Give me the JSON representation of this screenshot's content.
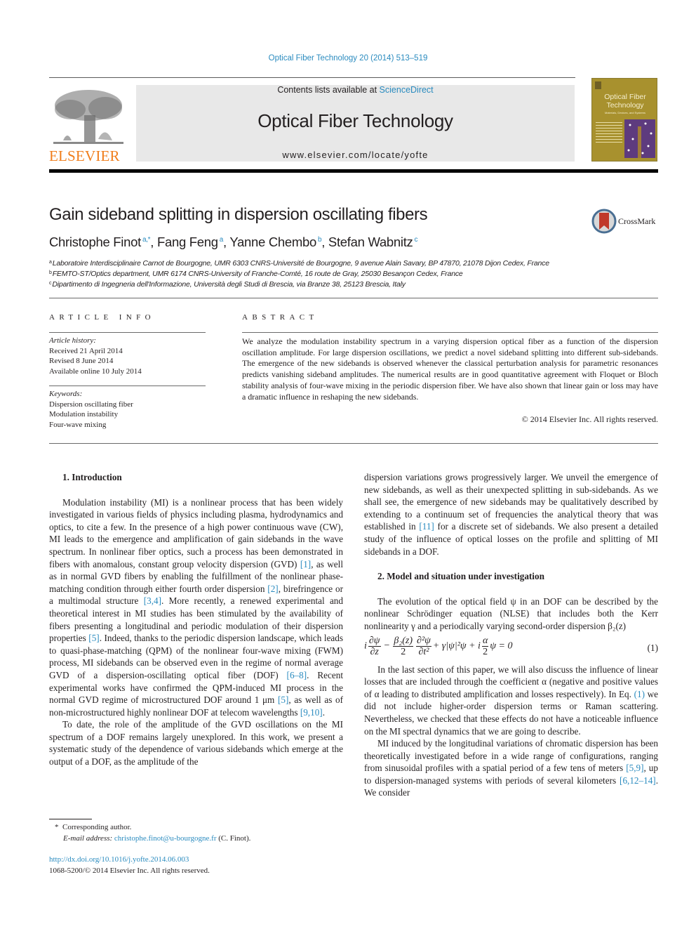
{
  "header": {
    "journal_ref": "Optical Fiber Technology 20 (2014) 513–519",
    "contents_prefix": "Contents lists available at ",
    "contents_link": "ScienceDirect",
    "journal_title": "Optical Fiber Technology",
    "journal_url": "www.elsevier.com/locate/yofte",
    "publisher_logo_text": "ELSEVIER",
    "cover": {
      "title_line1": "Optical Fiber",
      "title_line2": "Technology",
      "subtitle": "Materials, Devices, and Systems"
    }
  },
  "article": {
    "title": "Gain sideband splitting in dispersion oscillating fibers",
    "crossmark_label": "CrossMark",
    "authors": [
      {
        "name": "Christophe Finot",
        "sup": "a,*",
        "sep": ", "
      },
      {
        "name": "Fang Feng",
        "sup": "a",
        "sep": ", "
      },
      {
        "name": "Yanne Chembo",
        "sup": "b",
        "sep": ", "
      },
      {
        "name": "Stefan Wabnitz",
        "sup": "c",
        "sep": ""
      }
    ],
    "affiliations": [
      {
        "mark": "a",
        "text": "Laboratoire Interdisciplinaire Carnot de Bourgogne, UMR 6303 CNRS-Université de Bourgogne, 9 avenue Alain Savary, BP 47870, 21078 Dijon Cedex, France"
      },
      {
        "mark": "b",
        "text": "FEMTO-ST/Optics department, UMR 6174 CNRS-University of Franche-Comté, 16 route de Gray, 25030 Besançon Cedex, France"
      },
      {
        "mark": "c",
        "text": "Dipartimento di Ingegneria dell'Informazione, Università degli Studi di Brescia, via Branze 38, 25123 Brescia, Italy"
      }
    ]
  },
  "article_info": {
    "heading": "ARTICLE INFO",
    "history_label": "Article history:",
    "history": [
      "Received 21 April 2014",
      "Revised 8 June 2014",
      "Available online 10 July 2014"
    ],
    "keywords_label": "Keywords:",
    "keywords": [
      "Dispersion oscillating fiber",
      "Modulation instability",
      "Four-wave mixing"
    ]
  },
  "abstract": {
    "heading": "ABSTRACT",
    "text": "We analyze the modulation instability spectrum in a varying dispersion optical fiber as a function of the dispersion oscillation amplitude. For large dispersion oscillations, we predict a novel sideband splitting into different sub-sidebands. The emergence of the new sidebands is observed whenever the classical perturbation analysis for parametric resonances predicts vanishing sideband amplitudes. The numerical results are in good quantitative agreement with Floquet or Bloch stability analysis of four-wave mixing in the periodic dispersion fiber. We have also shown that linear gain or loss may have a dramatic influence in reshaping the new sidebands.",
    "copyright": "© 2014 Elsevier Inc. All rights reserved."
  },
  "body": {
    "sec1_heading": "1. Introduction",
    "sec1_p1": [
      {
        "t": "Modulation instability (MI) is a nonlinear process that has been widely investigated in various fields of physics including plasma, hydrodynamics and optics, to cite a few. In the presence of a high power continuous wave (CW), MI leads to the emergence and amplification of gain sidebands in the wave spectrum. In nonlinear fiber optics, such a process has been demonstrated in fibers with anomalous, constant group velocity dispersion (GVD) "
      },
      {
        "ref": "[1]"
      },
      {
        "t": ", as well as in normal GVD fibers by enabling the fulfillment of the nonlinear phase-matching condition through either fourth order dispersion "
      },
      {
        "ref": "[2]"
      },
      {
        "t": ", birefringence or a multimodal structure "
      },
      {
        "ref": "[3,4]"
      },
      {
        "t": ". More recently, a renewed experimental and theoretical interest in MI studies has been stimulated by the availability of fibers presenting a longitudinal and periodic modulation of their dispersion properties "
      },
      {
        "ref": "[5]"
      },
      {
        "t": ". Indeed, thanks to the periodic dispersion landscape, which leads to quasi-phase-matching (QPM) of the nonlinear four-wave mixing (FWM) process, MI sidebands can be observed even in the regime of normal average GVD of a dispersion-oscillating optical fiber (DOF) "
      },
      {
        "ref": "[6–8]"
      },
      {
        "t": ". Recent experimental works have confirmed the QPM-induced MI process in the normal GVD regime of microstructured DOF around 1 μm "
      },
      {
        "ref": "[5]"
      },
      {
        "t": ", as well as of non-microstructured highly nonlinear DOF at telecom wavelengths "
      },
      {
        "ref": "[9,10]"
      },
      {
        "t": "."
      }
    ],
    "sec1_p2_left": "To date, the role of the amplitude of the GVD oscillations on the MI spectrum of a DOF remains largely unexplored. In this work, we present a systematic study of the dependence of various sidebands which emerge at the output of a DOF, as the amplitude of the",
    "sec1_p2_right": [
      {
        "t": "dispersion variations grows progressively larger. We unveil the emergence of new sidebands, as well as their unexpected splitting in sub-sidebands. As we shall see, the emergence of new sidebands may be qualitatively described by extending to a continuum set of frequencies the analytical theory that was established in "
      },
      {
        "ref": "[11]"
      },
      {
        "t": " for a discrete set of sidebands. We also present a detailed study of the influence of optical losses on the profile and splitting of MI sidebands in a DOF."
      }
    ],
    "sec2_heading": "2. Model and situation under investigation",
    "sec2_p1": "The evolution of the optical field ψ in an DOF can be described by the nonlinear Schrödinger equation (NLSE) that includes both the Kerr nonlinearity γ and a periodically varying second-order dispersion β₂(z)",
    "equation": {
      "i": "i",
      "d_psi": "∂ψ",
      "d_z": "∂z",
      "minus": "−",
      "beta": "β₂(z)",
      "two": "2",
      "d2_psi": "∂²ψ",
      "d_t2": "∂t²",
      "nonlinear_term": "+ γ|ψ|²ψ + i",
      "alpha": "α",
      "tail": "ψ = 0",
      "number": "(1)"
    },
    "sec2_p2": [
      {
        "t": "In the last section of this paper, we will also discuss the influence of linear losses that are included through the coefficient α (negative and positive values of α leading to distributed amplification and losses respectively). In Eq. "
      },
      {
        "ref": "(1)"
      },
      {
        "t": " we did not include higher-order dispersion terms or Raman scattering. Nevertheless, we checked that these effects do not have a noticeable influence on the MI spectral dynamics that we are going to describe."
      }
    ],
    "sec2_p3": [
      {
        "t": "MI induced by the longitudinal variations of chromatic dispersion has been theoretically investigated before in a wide range of configurations, ranging from sinusoidal profiles with a spatial period of a few tens of meters "
      },
      {
        "ref": "[5,9]"
      },
      {
        "t": ", up to dispersion-managed systems with periods of several kilometers "
      },
      {
        "ref": "[6,12–14]"
      },
      {
        "t": ". We consider"
      }
    ]
  },
  "footnotes": {
    "star": "*",
    "corresponding": "Corresponding author.",
    "email_label": "E-mail address:",
    "email": "christophe.finot@u-bourgogne.fr",
    "email_suffix": " (C. Finot).",
    "doi": "http://dx.doi.org/10.1016/j.yofte.2014.06.003",
    "issn_copyright": "1068-5200/© 2014 Elsevier Inc. All rights reserved."
  },
  "colors": {
    "link": "#2a8bbf",
    "elsevier_orange": "#f07d1a",
    "banner_gray": "#e8e8e8",
    "cover_gold": "#a8912e",
    "cover_purple": "#5e3b7e",
    "crossmark_red": "#c0392b"
  }
}
